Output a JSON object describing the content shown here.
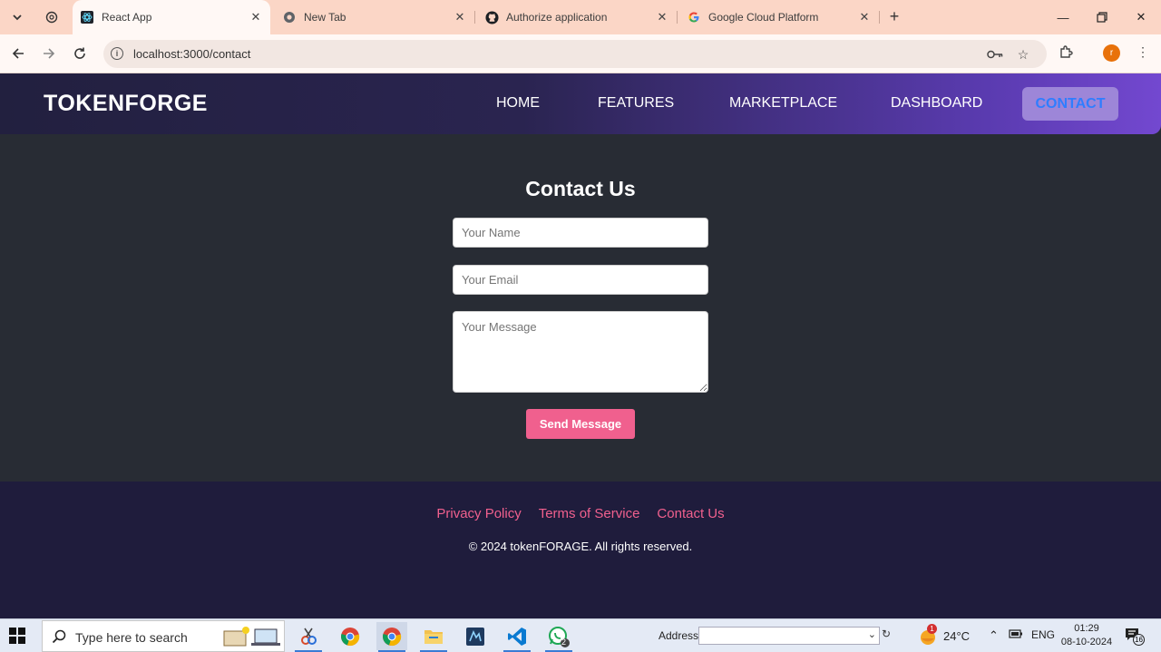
{
  "browser": {
    "tabs": [
      {
        "title": "React App",
        "active": true
      },
      {
        "title": "New Tab",
        "active": false
      },
      {
        "title": "Authorize application",
        "active": false
      },
      {
        "title": "Google Cloud Platform",
        "active": false
      }
    ],
    "url": "localhost:3000/contact",
    "profile_initial": "r"
  },
  "navbar": {
    "brand": "TOKENFORGE",
    "links": [
      "HOME",
      "FEATURES",
      "MARKETPLACE",
      "DASHBOARD",
      "CONTACT"
    ],
    "active_link": "CONTACT"
  },
  "contact": {
    "title": "Contact Us",
    "name_placeholder": "Your Name",
    "email_placeholder": "Your Email",
    "message_placeholder": "Your Message",
    "send_label": "Send Message"
  },
  "footer": {
    "links": [
      "Privacy Policy",
      "Terms of Service",
      "Contact Us"
    ],
    "copyright": "© 2024 tokenFORAGE. All rights reserved."
  },
  "taskbar": {
    "search_placeholder": "Type here to search",
    "address_label": "Address",
    "weather_temp": "24°C",
    "weather_badge": "1",
    "language": "ENG",
    "time": "01:29",
    "date": "08-10-2024",
    "notification_count": "16",
    "whatsapp_badge": "2"
  },
  "colors": {
    "accent_pink": "#f0608e",
    "active_link_text": "#2f7dff",
    "active_link_bg": "#9d86d8",
    "page_bg": "#282c34",
    "footer_bg": "#1f1c3c"
  }
}
